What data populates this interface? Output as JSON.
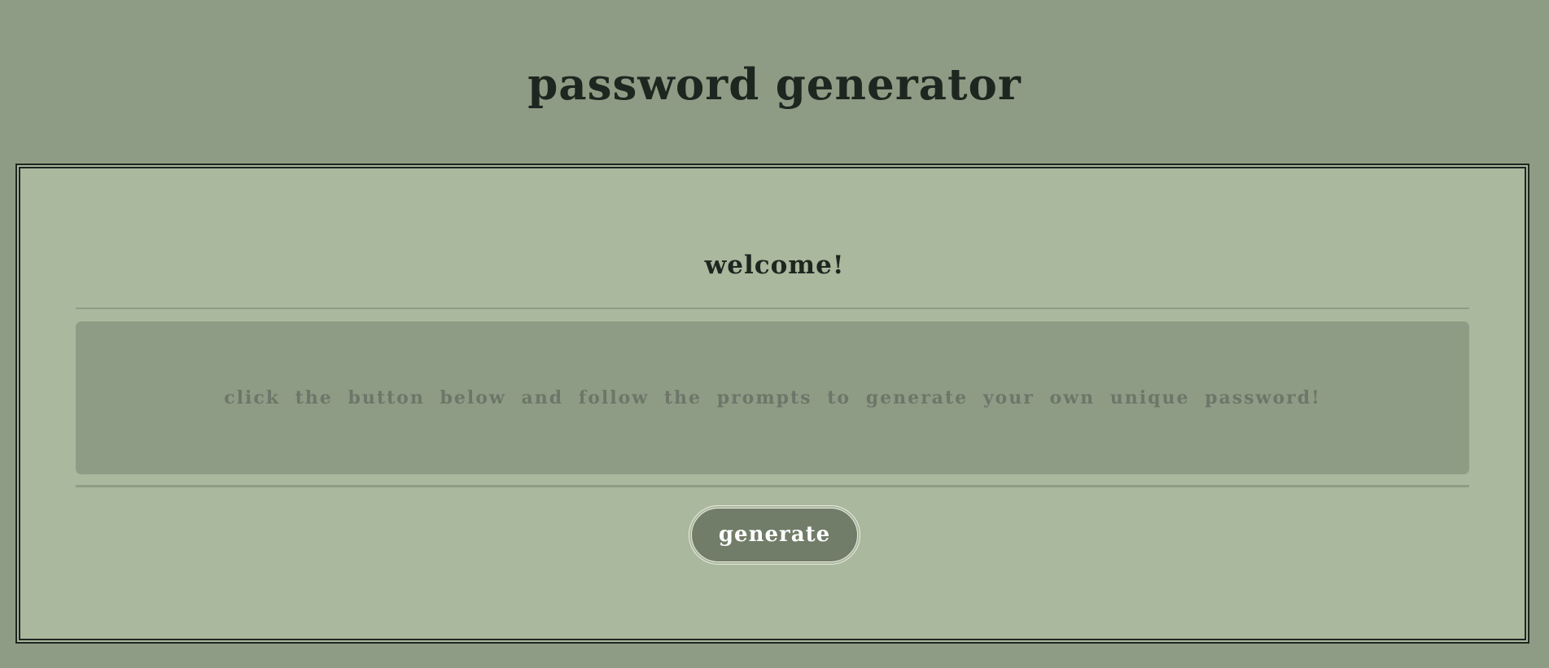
{
  "header": {
    "title": "password generator"
  },
  "card": {
    "heading": "welcome!",
    "message": "click the button below and follow the prompts to generate your own unique password!",
    "button_label": "generate"
  },
  "colors": {
    "background": "#8f9c85",
    "card": "#aab89d",
    "text_dark": "#1e2620",
    "message_text": "#6d7669",
    "button": "#727d69",
    "button_text": "#ffffff"
  }
}
